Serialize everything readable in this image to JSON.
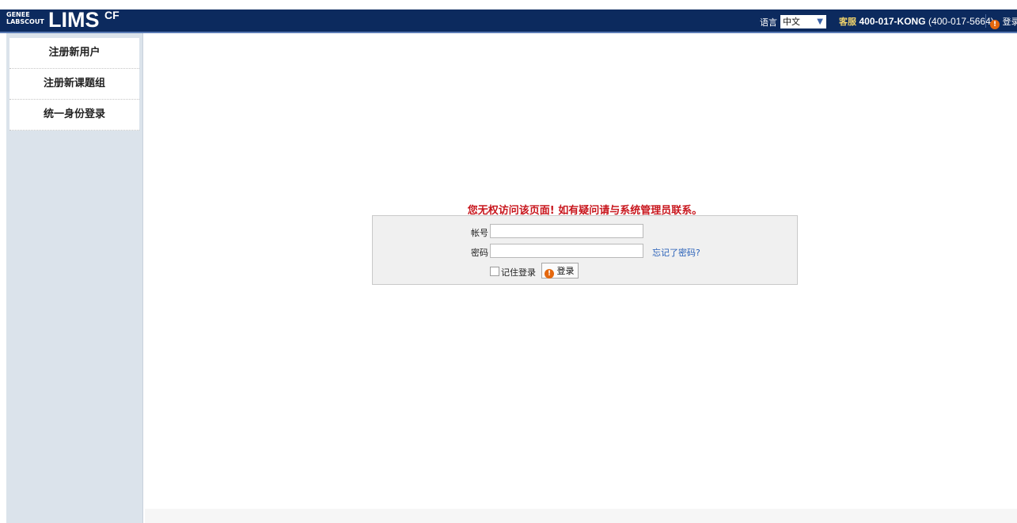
{
  "header": {
    "logo_small_top": "GENEE",
    "logo_small_bottom": "LABSCOUT",
    "logo_main": "LIMS",
    "logo_sup": "CF",
    "language_label": "语言",
    "language_value": "中文",
    "service_label": "客服",
    "service_phone": "400-017-KONG",
    "service_phone_alt": "(400-017-5664)",
    "login_label": "登录"
  },
  "sidebar": {
    "items": [
      {
        "label": "注册新用户"
      },
      {
        "label": "注册新课题组"
      },
      {
        "label": "统一身份登录"
      }
    ]
  },
  "main": {
    "error_message": "您无权访问该页面! 如有疑问请与系统管理员联系。",
    "form": {
      "account_label": "帐号",
      "account_value": "",
      "password_label": "密码",
      "password_value": "",
      "forgot_link": "忘记了密码?",
      "remember_label": "记住登录",
      "remember_checked": false,
      "login_button": "登录"
    }
  },
  "colors": {
    "header_bg": "#0c2a5e",
    "sidebar_bg": "#dbe3eb",
    "error_text": "#c8161d",
    "link": "#2860b8",
    "icon_orange": "#e4670d"
  },
  "icons": {
    "login_icon": "orange-power-icon",
    "dropdown_icon": "triangle-down-icon"
  }
}
